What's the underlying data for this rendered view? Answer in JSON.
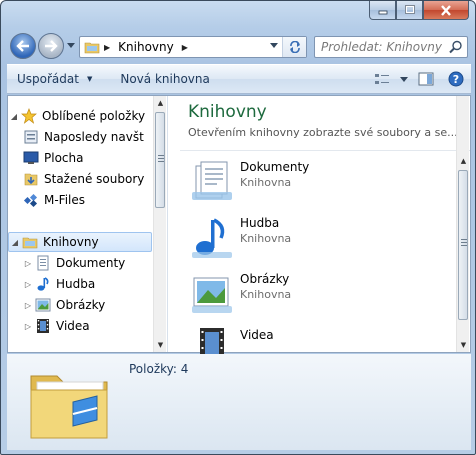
{
  "window": {
    "caption_buttons": [
      "minimize",
      "maximize",
      "close"
    ]
  },
  "address_bar": {
    "path": "Knihovny",
    "search_placeholder": "Prohledat: Knihovny"
  },
  "toolbar": {
    "organize_label": "Uspořádat",
    "new_library_label": "Nová knihovna"
  },
  "nav_pane": {
    "favorites": {
      "label": "Oblíbené položky",
      "items": [
        {
          "label": "Naposledy navšt",
          "icon": "recent-places-icon"
        },
        {
          "label": "Plocha",
          "icon": "desktop-icon"
        },
        {
          "label": "Stažené soubory",
          "icon": "downloads-icon"
        },
        {
          "label": "M-Files",
          "icon": "mfiles-icon"
        }
      ]
    },
    "libraries": {
      "label": "Knihovny",
      "items": [
        {
          "label": "Dokumenty",
          "icon": "documents-icon"
        },
        {
          "label": "Hudba",
          "icon": "music-icon"
        },
        {
          "label": "Obrázky",
          "icon": "pictures-icon"
        },
        {
          "label": "Videa",
          "icon": "videos-icon"
        }
      ]
    }
  },
  "main": {
    "title": "Knihovny",
    "subtitle": "Otevřením knihovny zobrazte své soubory a se...",
    "items": [
      {
        "name": "Dokumenty",
        "type": "Knihovna"
      },
      {
        "name": "Hudba",
        "type": "Knihovna"
      },
      {
        "name": "Obrázky",
        "type": "Knihovna"
      },
      {
        "name": "Videa",
        "type": ""
      }
    ]
  },
  "details": {
    "count_label": "Položky: 4"
  },
  "colors": {
    "accent_title": "#1e6a3e",
    "toolbar_text": "#1e395b"
  }
}
